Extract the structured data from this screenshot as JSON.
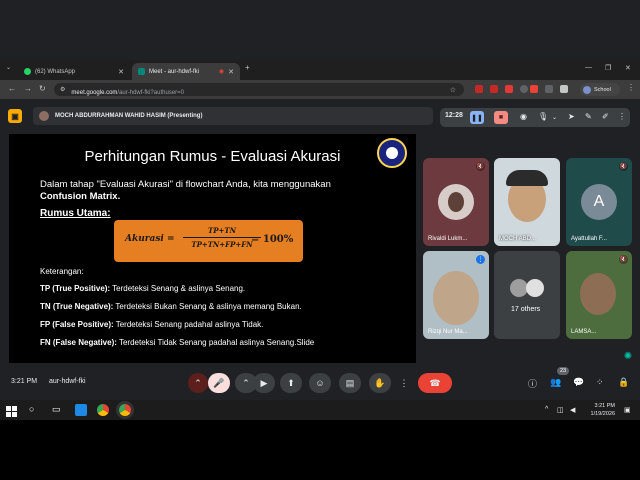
{
  "browser": {
    "tabs": [
      {
        "label": "(62) WhatsApp",
        "active": false
      },
      {
        "label": "Meet - aur-hdwf-fki",
        "active": true
      }
    ],
    "new_tab": "+",
    "url_host": "meet.google.com",
    "url_path": "/aur-hdwf-fki?authuser=0",
    "profile_label": "School"
  },
  "meet": {
    "presenter_banner": "MOCH ABDURRAHMAN WAHID HASIM (Presenting)",
    "present_time": "12:28",
    "bottom_time": "3:21 PM",
    "meeting_code": "aur-hdwf-fki",
    "participants_badge": "23"
  },
  "slide": {
    "title": "Perhitungan Rumus - Evaluasi Akurasi",
    "intro": "Dalam tahap \"Evaluasi Akurasi\" di flowchart Anda, kita menggunakan",
    "intro_bold": "Confusion Matrix.",
    "rumus_heading": "Rumus Utama:",
    "formula_left": "Akurasi =",
    "formula_numerator": "TP+TN",
    "formula_denominator": "TP+TN+FP+FN",
    "formula_right": "= 100%",
    "keterangan": "Keterangan:",
    "terms": [
      {
        "label": "TP (True Positive):",
        "text": " Terdeteksi Senang & aslinya Senang."
      },
      {
        "label": "TN (True Negative):",
        "text": " Terdeteksi Bukan Senang & aslinya memang Bukan."
      },
      {
        "label": "FP (False Positive):",
        "text": " Terdeteksi Senang padahal aslinya Tidak."
      },
      {
        "label": "FN (False Negative):",
        "text": " Terdeteksi Tidak Senang padahal aslinya Senang.Slide"
      }
    ]
  },
  "participants": [
    {
      "name": "Rivaldi Lukm...",
      "type": "photo-avatar"
    },
    {
      "name": "MOCH ABD...",
      "type": "video"
    },
    {
      "name": "Ayattullah F...",
      "type": "letter-avatar",
      "letter": "A"
    },
    {
      "name": "Rizqi Nur Ma...",
      "type": "video"
    },
    {
      "name": "17 others",
      "type": "group"
    },
    {
      "name": "LAMSA...",
      "type": "video"
    }
  ],
  "taskbar": {
    "time": "3:21 PM",
    "date": "1/19/2026"
  },
  "colors": {
    "meet_bg": "#202124",
    "formula_box": "#e67e22",
    "hangup": "#ea4335",
    "accent_blue": "#8ab4f8"
  }
}
